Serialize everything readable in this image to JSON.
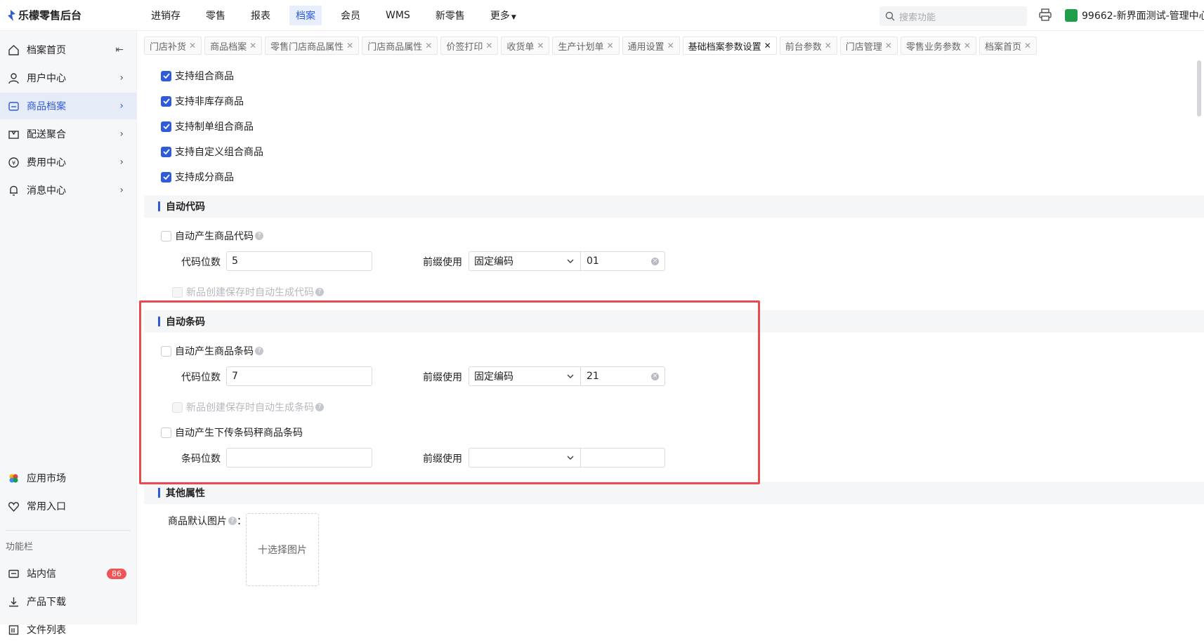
{
  "app": {
    "title": "乐檬零售后台"
  },
  "topnav": [
    "进销存",
    "零售",
    "报表",
    "档案",
    "会员",
    "WMS",
    "新零售",
    "更多"
  ],
  "topnav_active": "档案",
  "search": {
    "placeholder": "搜索功能"
  },
  "store": {
    "label": "99662-新界面测试-管理中心"
  },
  "sidebar": {
    "items": [
      {
        "label": "档案首页",
        "icon": "home-icon"
      },
      {
        "label": "用户中心",
        "icon": "user-icon"
      },
      {
        "label": "商品档案",
        "icon": "product-icon"
      },
      {
        "label": "配送聚合",
        "icon": "delivery-icon"
      },
      {
        "label": "费用中心",
        "icon": "money-icon"
      },
      {
        "label": "消息中心",
        "icon": "bell-icon"
      }
    ],
    "bottom": [
      {
        "label": "应用市场",
        "icon": "app-market-icon"
      },
      {
        "label": "常用入口",
        "icon": "heart-icon"
      }
    ],
    "section_label": "功能栏",
    "tools": [
      {
        "label": "站内信",
        "icon": "mail-icon",
        "badge": "86"
      },
      {
        "label": "产品下载",
        "icon": "download-icon"
      },
      {
        "label": "文件列表",
        "icon": "file-list-icon"
      }
    ]
  },
  "tabs": [
    "门店补货",
    "商品档案",
    "零售门店商品属性",
    "门店商品属性",
    "价签打印",
    "收货单",
    "生产计划单",
    "通用设置",
    "基础档案参数设置",
    "前台参数",
    "门店管理",
    "零售业务参数",
    "档案首页"
  ],
  "tabs_active": "基础档案参数设置",
  "combo": {
    "items": [
      {
        "label": "支持组合商品",
        "checked": true
      },
      {
        "label": "支持非库存商品",
        "checked": true
      },
      {
        "label": "支持制单组合商品",
        "checked": true
      },
      {
        "label": "支持自定义组合商品",
        "checked": true
      },
      {
        "label": "支持成分商品",
        "checked": true
      }
    ]
  },
  "auto_code": {
    "title": "自动代码",
    "toggle_label": "自动产生商品代码",
    "digits_label": "代码位数",
    "digits_value": "5",
    "prefix_label": "前缀使用",
    "prefix_type": "固定编码",
    "prefix_value": "01",
    "auto_gen_label": "新品创建保存时自动生成代码"
  },
  "auto_barcode": {
    "title": "自动条码",
    "toggle_label": "自动产生商品条码",
    "digits_label": "代码位数",
    "digits_value": "7",
    "prefix_label": "前缀使用",
    "prefix_type": "固定编码",
    "prefix_value": "21",
    "auto_gen_label": "新品创建保存时自动生成条码",
    "scale_toggle_label": "自动产生下传条码秤商品条码",
    "scale_digits_label": "条码位数",
    "scale_digits_value": "",
    "scale_prefix_label": "前缀使用",
    "scale_prefix_type": "",
    "scale_prefix_value": ""
  },
  "other": {
    "title": "其他属性",
    "image_label": "商品默认图片",
    "image_button": "十选择图片"
  },
  "colors": {
    "accent": "#2f5bd8",
    "highlight": "#e84a4f",
    "badge": "#f05454"
  }
}
